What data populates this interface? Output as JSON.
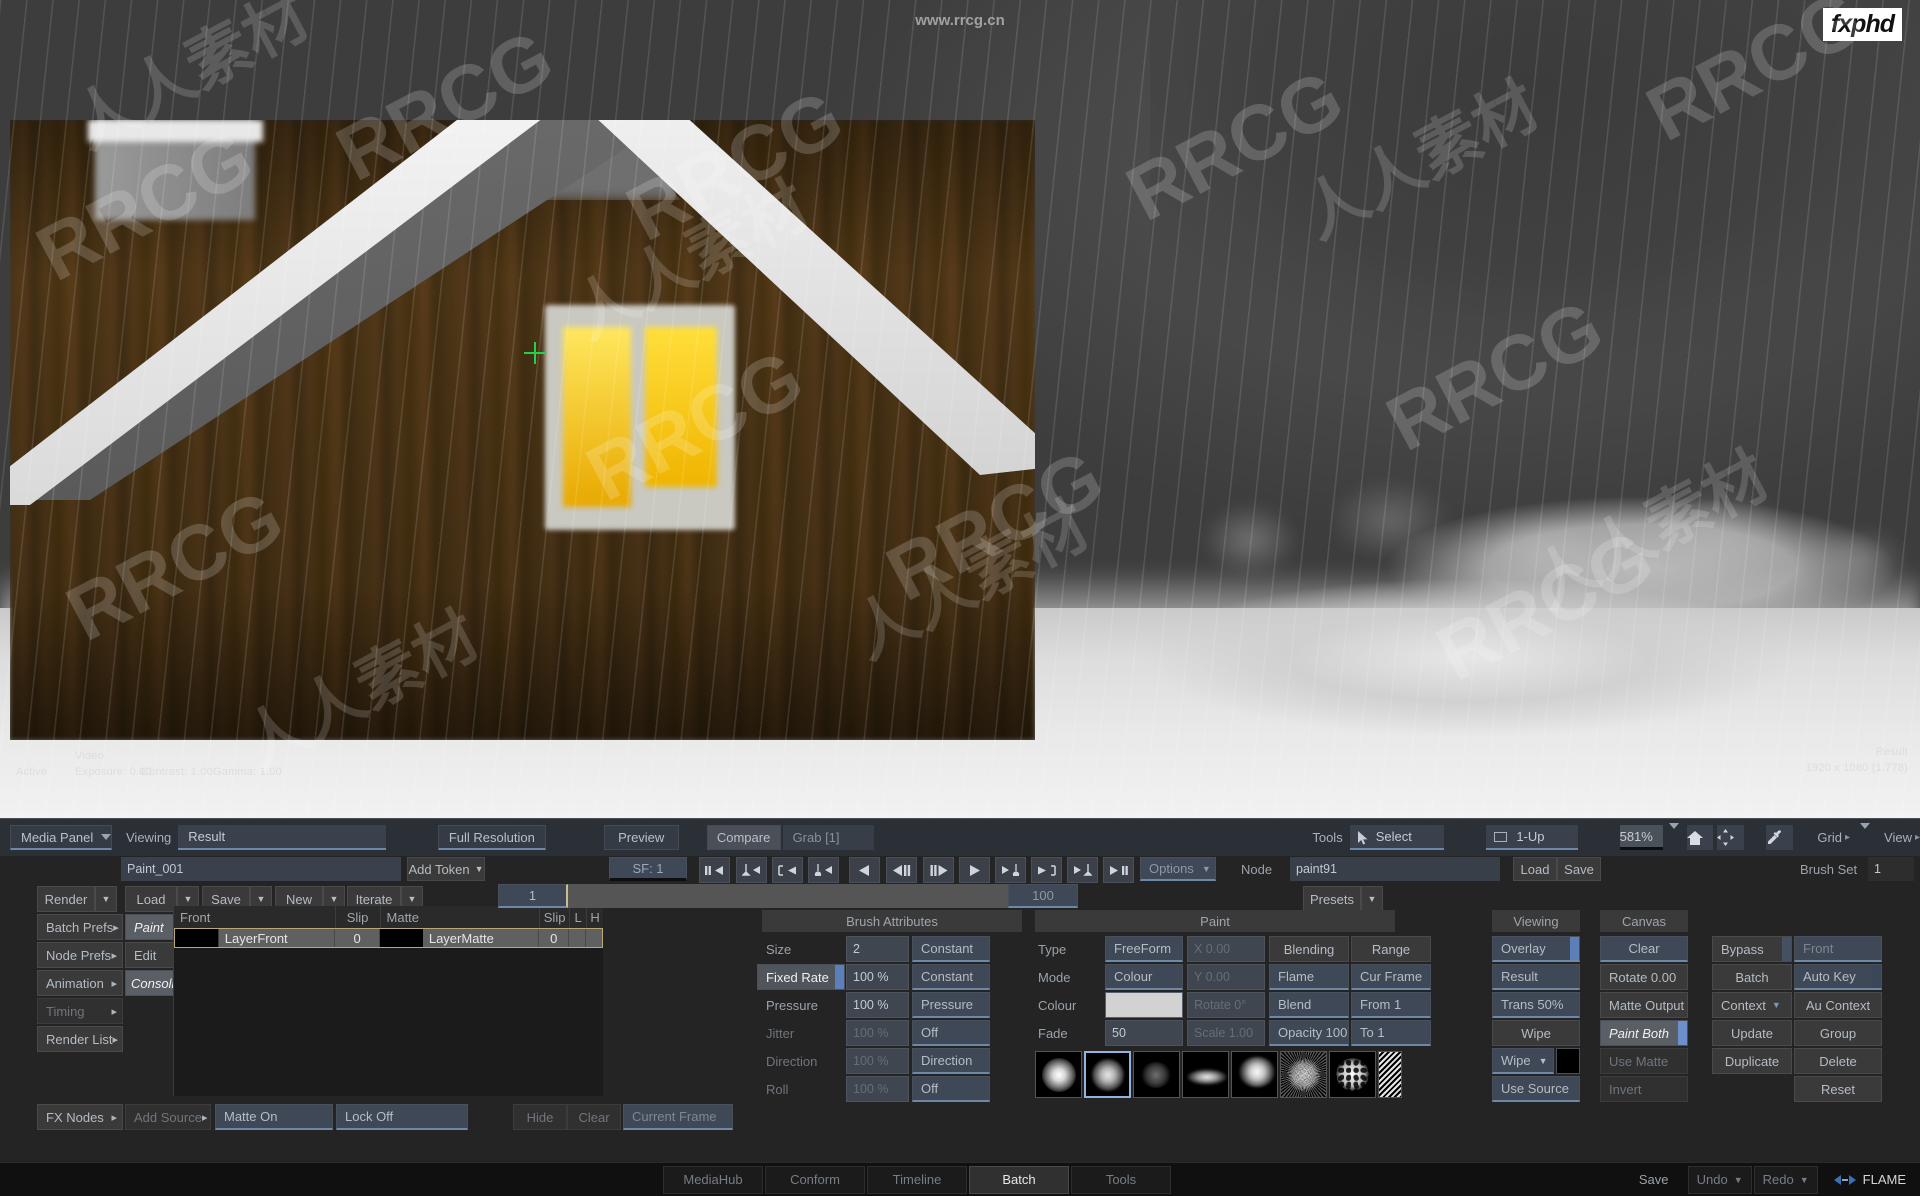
{
  "viewer": {
    "watermark_top": "www.rrcg.cn",
    "brand": "fxphd",
    "status_active": "Active",
    "video_label": "Video",
    "exposure": "Exposure: 0.00",
    "contrast": "Contrast: 1.00",
    "gamma": "Gamma: 1.00",
    "result_label": "Result",
    "dimensions": "1920 x 1080 (1.778)"
  },
  "toolbar": {
    "media_panel": "Media Panel",
    "viewing_label": "Viewing",
    "viewing_value": "Result",
    "full_resolution": "Full Resolution",
    "preview": "Preview",
    "compare": "Compare",
    "grab": "Grab [1]",
    "tools_label": "Tools",
    "select": "Select",
    "layout": "1-Up",
    "zoom": "581%",
    "grid": "Grid",
    "view": "View"
  },
  "project": {
    "name_value": "Paint_001",
    "add_token": "Add Token",
    "actions": [
      "Render",
      "Load",
      "Save",
      "New",
      "Iterate"
    ],
    "menu_left": [
      "Batch Prefs",
      "Node Prefs",
      "Animation",
      "Timing",
      "Render List"
    ],
    "menu_right": [
      "Paint",
      "Edit",
      "Consolidate"
    ],
    "fx_nodes": "FX Nodes",
    "add_source": "Add Source",
    "matte_on": "Matte On",
    "lock_off": "Lock Off",
    "hide": "Hide",
    "clear": "Clear",
    "current_frame": "Current Frame"
  },
  "layers": {
    "columns": [
      "Front",
      "Slip",
      "Matte",
      "Slip",
      "L",
      "H"
    ],
    "rows": [
      {
        "front": "LayerFront",
        "slip1": "0",
        "matte": "LayerMatte",
        "slip2": "0",
        "l": "",
        "h": ""
      }
    ]
  },
  "transport": {
    "sf_label": "SF: 1",
    "frame_value": "1",
    "range_end": "100",
    "options": "Options",
    "node_label": "Node",
    "node_value": "paint91",
    "load": "Load",
    "save": "Save",
    "brush_set_label": "Brush Set",
    "brush_set_value": "1",
    "presets": "Presets"
  },
  "brush_attributes": {
    "title": "Brush Attributes",
    "rows": [
      {
        "label": "Size",
        "value": "2",
        "mode": "Constant",
        "fill": 8,
        "label_sel": false
      },
      {
        "label": "Fixed Rate",
        "value": "100 %",
        "mode": "Constant",
        "fill": 100,
        "label_sel": true
      },
      {
        "label": "Pressure",
        "value": "100 %",
        "mode": "Pressure",
        "fill": 100,
        "label_sel": false
      },
      {
        "label": "Jitter",
        "value": "100 %",
        "mode": "Off",
        "fill": 100,
        "label_sel": false
      },
      {
        "label": "Direction",
        "value": "100 %",
        "mode": "Direction",
        "fill": 100,
        "label_sel": false
      },
      {
        "label": "Roll",
        "value": "100 %",
        "mode": "Off",
        "fill": 100,
        "label_sel": false
      }
    ]
  },
  "paint": {
    "title": "Paint",
    "type_label": "Type",
    "type_value": "FreeForm",
    "mode_label": "Mode",
    "mode_value": "Colour",
    "colour_label": "Colour",
    "colour_swatch": "#d2d2d2",
    "fade_label": "Fade",
    "fade_value": "50",
    "x_value": "X 0.00",
    "y_value": "Y 0.00",
    "rotate_value": "Rotate 0°",
    "scale_value": "Scale 1.00",
    "blending": "Blending",
    "flame": "Flame",
    "blend": "Blend",
    "opacity": "Opacity 100",
    "range": "Range",
    "cur_frame": "Cur Frame",
    "from": "From 1",
    "to": "To 1"
  },
  "viewing_panel": {
    "title": "Viewing",
    "overlay": "Overlay",
    "result": "Result",
    "trans": "Trans 50%",
    "wipe_title": "Wipe",
    "wipe_mode": "Wipe",
    "wipe_swatch": "#000000",
    "use_source": "Use Source"
  },
  "canvas_panel": {
    "title": "Canvas",
    "clear": "Clear",
    "rotate": "Rotate 0.00",
    "matte_output": "Matte Output",
    "paint_both": "Paint Both",
    "use_matte": "Use Matte",
    "invert": "Invert"
  },
  "node_panel": {
    "bypass": "Bypass",
    "front": "Front",
    "batch": "Batch",
    "auto_key": "Auto Key",
    "context": "Context",
    "au_context": "Au Context",
    "update": "Update",
    "group": "Group",
    "duplicate": "Duplicate",
    "delete": "Delete",
    "reset": "Reset"
  },
  "statusbar": {
    "tabs": [
      "MediaHub",
      "Conform",
      "Timeline",
      "Batch",
      "Tools"
    ],
    "active_tab": "Batch",
    "save": "Save",
    "undo": "Undo",
    "redo": "Redo",
    "app": "FLAME"
  },
  "colors": {
    "accent_blue": "#5b7fb8",
    "panel_bg": "#242424",
    "toolbar_bg": "#2b2f36",
    "button_bg": "#3c4149",
    "green_crosshair": "#22d04a"
  }
}
